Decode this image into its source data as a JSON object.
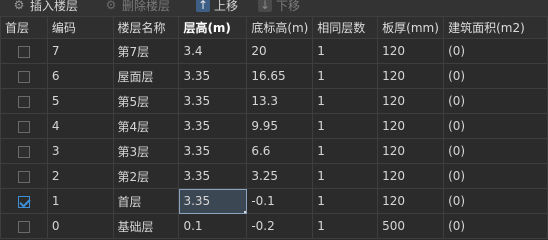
{
  "toolbar": {
    "insert_label": "插入楼层",
    "delete_label": "删除楼层",
    "up_label": "上移",
    "down_label": "下移"
  },
  "table": {
    "headers": [
      "首层",
      "编码",
      "楼层名称",
      "层高(m)",
      "底标高(m)",
      "相同层数",
      "板厚(mm)",
      "建筑面积(m2)"
    ],
    "rows": [
      {
        "first_floor": false,
        "code": "7",
        "name": "第7层",
        "height": "3.4",
        "bottom": "20",
        "same": "1",
        "thickness": "120",
        "area": "(0)"
      },
      {
        "first_floor": false,
        "code": "6",
        "name": "屋面层",
        "height": "3.35",
        "bottom": "16.65",
        "same": "1",
        "thickness": "120",
        "area": "(0)"
      },
      {
        "first_floor": false,
        "code": "5",
        "name": "第5层",
        "height": "3.35",
        "bottom": "13.3",
        "same": "1",
        "thickness": "120",
        "area": "(0)"
      },
      {
        "first_floor": false,
        "code": "4",
        "name": "第4层",
        "height": "3.35",
        "bottom": "9.95",
        "same": "1",
        "thickness": "120",
        "area": "(0)"
      },
      {
        "first_floor": false,
        "code": "3",
        "name": "第3层",
        "height": "3.35",
        "bottom": "6.6",
        "same": "1",
        "thickness": "120",
        "area": "(0)"
      },
      {
        "first_floor": false,
        "code": "2",
        "name": "第2层",
        "height": "3.35",
        "bottom": "3.25",
        "same": "1",
        "thickness": "120",
        "area": "(0)"
      },
      {
        "first_floor": true,
        "code": "1",
        "name": "首层",
        "height": "3.35",
        "bottom": "-0.1",
        "same": "1",
        "thickness": "120",
        "area": "(0)"
      },
      {
        "first_floor": false,
        "code": "0",
        "name": "基础层",
        "height": "0.1",
        "bottom": "-0.2",
        "same": "1",
        "thickness": "500",
        "area": "(0)"
      }
    ]
  }
}
